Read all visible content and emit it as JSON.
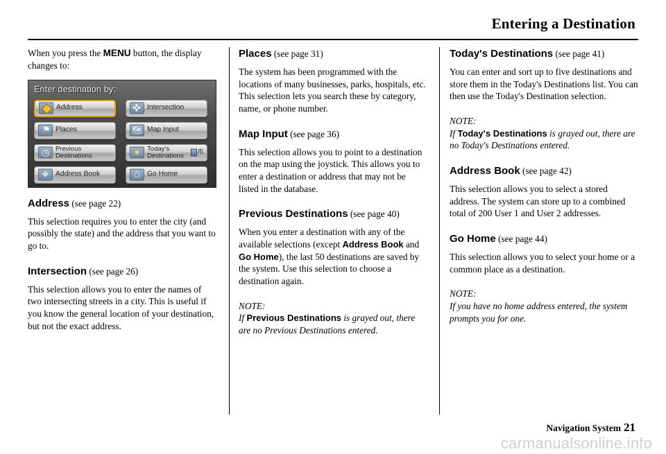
{
  "header": {
    "title": "Entering a Destination"
  },
  "footer": {
    "label": "Navigation System",
    "page": "21",
    "watermark_text": "carmanualsonline.info"
  },
  "nav_screen": {
    "title": "Enter destination by:",
    "page_indicator": "/5",
    "buttons": [
      {
        "label": "Address",
        "icon": "diamond-icon",
        "selected": true
      },
      {
        "label": "Intersection",
        "icon": "cross-roads-icon",
        "selected": false
      },
      {
        "label": "Places",
        "icon": "flag-icon",
        "selected": false
      },
      {
        "label": "Map Input",
        "icon": "map-icon",
        "selected": false
      },
      {
        "label": "Previous\nDestinations",
        "icon": "clock-icon",
        "selected": false
      },
      {
        "label": "Today's\nDestinations",
        "icon": "star-icon",
        "selected": false
      },
      {
        "label": "Address Book",
        "icon": "book-icon",
        "selected": false
      },
      {
        "label": "Go Home",
        "icon": "home-icon",
        "selected": false
      }
    ]
  },
  "column1": {
    "intro_pre": "When you press the ",
    "intro_menu": "MENU",
    "intro_post": " button, the display changes to:",
    "sections": [
      {
        "term": "Address",
        "ref": "(see page 22)",
        "body": "This selection requires you to enter the city (and possibly the state) and the address that you want to go to."
      },
      {
        "term": "Intersection",
        "ref": "(see page 26)",
        "body": "This selection allows you to enter the names of two intersecting streets in a city. This is useful if you know the general location of your destination, but not the exact address."
      }
    ]
  },
  "column2": {
    "sections": [
      {
        "term": "Places",
        "ref": "(see page 31)",
        "body": "The system has been programmed with the locations of many businesses, parks, hospitals, etc. This selection lets you search these by category, name, or phone number."
      },
      {
        "term": "Map Input",
        "ref": "(see page 36)",
        "body": "This selection allows you to point to a destination on the map using the joystick. This allows you to enter a destination or address that may not be listed in the database."
      },
      {
        "term": "Previous Destinations",
        "ref": "(see page 40)",
        "body_part1": "When you enter a destination with any of the available selections (except ",
        "body_bold1": "Address Book",
        "body_mid": " and ",
        "body_bold2": "Go Home",
        "body_part2": "), the last 50 destinations are saved by the system. Use this selection to choose a destination again."
      }
    ],
    "note": {
      "label": "NOTE:",
      "if": "If",
      "bold": "Previous Destinations",
      "rest": "is grayed out, there are no Previous Destinations entered."
    }
  },
  "column3": {
    "sections": [
      {
        "term": "Today's Destinations",
        "ref": "(see page 41)",
        "body": "You can enter and sort up to five destinations and store them in the Today's Destinations list. You can then use the Today's Destination selection."
      }
    ],
    "note1": {
      "label": "NOTE:",
      "if": "If",
      "bold": "Today's Destinations",
      "rest": "is grayed out, there are no Today's Destinations entered."
    },
    "sections2": [
      {
        "term": "Address Book",
        "ref": "(see page 42)",
        "body": "This selection allows you to select a stored address. The system can store up to a combined total of  200 User 1 and User 2 addresses."
      },
      {
        "term": "Go Home",
        "ref": "(see page 44)",
        "body": "This selection allows you to select your home or a common place as a destination."
      }
    ],
    "note2": {
      "label": "NOTE:",
      "text": "If you have no home address entered, the system prompts you for one."
    }
  }
}
